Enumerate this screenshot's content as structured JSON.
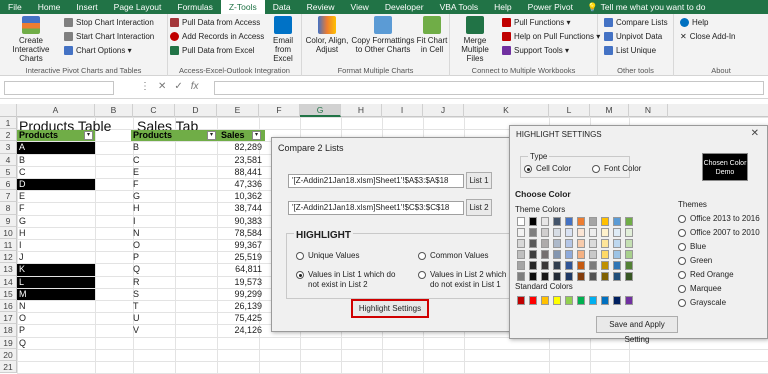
{
  "ribbon_tabs": [
    "File",
    "Home",
    "Insert",
    "Page Layout",
    "Formulas",
    "Z-Tools",
    "Data",
    "Review",
    "View",
    "Developer",
    "VBA Tools",
    "Help",
    "Power Pivot"
  ],
  "active_tab_index": 5,
  "tell_me": "Tell me what you want to do",
  "groups": {
    "g1": {
      "label": "Interactive Pivot Charts and Tables",
      "create": "Create Interactive Charts",
      "stop": "Stop Chart Interaction",
      "start": "Start Chart Interaction",
      "options": "Chart Options"
    },
    "g2": {
      "label": "Access-Excel-Outlook Integration",
      "pull_access": "Pull Data from Access",
      "add_records": "Add Records in Access",
      "pull_excel": "Pull Data from Excel",
      "email": "Email from Excel"
    },
    "g3": {
      "label": "Format Multiple Charts",
      "color": "Color, Align, Adjust",
      "copy_fmt": "Copy Formattings to Other Charts",
      "fit": "Fit Chart in Cell"
    },
    "g4": {
      "label": "Connect to Multiple Workbooks",
      "merge": "Merge Multiple Files",
      "pull_fn": "Pull Functions",
      "help_pull": "Help on Pull Functions",
      "support": "Support Tools"
    },
    "g5": {
      "label": "Other tools",
      "compare": "Compare Lists",
      "unpivot": "Unpivot Data",
      "list_unique": "List Unique"
    },
    "g6": {
      "label": "About",
      "help": "Help",
      "close": "Close Add-In"
    }
  },
  "formula_bar": {
    "fx": "fx",
    "namebox": "",
    "value": ""
  },
  "columns": [
    "A",
    "B",
    "C",
    "D",
    "E",
    "F",
    "G",
    "H",
    "I",
    "J",
    "K",
    "L",
    "M",
    "N"
  ],
  "sheet": {
    "products_title": "Products Table",
    "sales_title": "Sales Tab",
    "products_header": "Products",
    "sales_header_products": "Products",
    "sales_header_sales": "Sales",
    "products": [
      "A",
      "B",
      "C",
      "D",
      "E",
      "F",
      "G",
      "H",
      "I",
      "J",
      "K",
      "L",
      "M",
      "N",
      "O",
      "P",
      "Q"
    ],
    "products_highlighted": [
      true,
      false,
      false,
      true,
      false,
      false,
      false,
      false,
      false,
      false,
      true,
      true,
      true,
      false,
      false,
      false,
      false
    ],
    "sales_products": [
      "B",
      "C",
      "E",
      "F",
      "G",
      "H",
      "I",
      "N",
      "O",
      "P",
      "Q",
      "R",
      "S",
      "T",
      "U",
      "V"
    ],
    "sales_values": [
      "82,289",
      "23,581",
      "88,441",
      "47,336",
      "10,362",
      "38,744",
      "90,383",
      "78,584",
      "99,367",
      "25,519",
      "64,811",
      "19,573",
      "99,299",
      "26,139",
      "75,425",
      "24,126"
    ]
  },
  "compare_dialog": {
    "title": "Compare 2 Lists",
    "list1_ref": "'[Z-Addin21Jan18.xlsm]Sheet1'!$A$3:$A$18",
    "list2_ref": "'[Z-Addin21Jan18.xlsm]Sheet1'!$C$3:$C$18",
    "list1_btn": "List 1",
    "list2_btn": "List 2",
    "highlight_heading": "HIGHLIGHT",
    "opt_unique": "Unique Values",
    "opt_common": "Common Values",
    "opt_list1": "Values in List 1 which do not exist in List 2",
    "opt_list2": "Values in List 2 which do not exist in List 1",
    "settings_btn": "Highlight Settings"
  },
  "hs_dialog": {
    "title": "HIGHLIGHT SETTINGS",
    "close": "✕",
    "type_label": "Type",
    "cell_color": "Cell Color",
    "font_color": "Font Color",
    "demo": "Chosen Color Demo",
    "choose_color": "Choose Color",
    "theme_colors": "Theme Colors",
    "standard_colors": "Standard Colors",
    "themes_label": "Themes",
    "themes": [
      "Office 2013 to 2016",
      "Office 2007 to 2010",
      "Blue",
      "Green",
      "Red Orange",
      "Marquee",
      "Grayscale"
    ],
    "apply_btn": "Save and Apply Setting",
    "theme_grid": [
      [
        "#ffffff",
        "#000000",
        "#e7e6e6",
        "#44546a",
        "#4472c4",
        "#ed7d31",
        "#a5a5a5",
        "#ffc000",
        "#5b9bd5",
        "#70ad47"
      ],
      [
        "#f2f2f2",
        "#7f7f7f",
        "#d0cece",
        "#d6dce4",
        "#d9e2f3",
        "#fbe5d5",
        "#ededed",
        "#fff2cc",
        "#deebf6",
        "#e2efd9"
      ],
      [
        "#d8d8d8",
        "#595959",
        "#aeabab",
        "#adb9ca",
        "#b4c6e7",
        "#f7cbac",
        "#dbdbdb",
        "#fee599",
        "#bdd7ee",
        "#c5e0b3"
      ],
      [
        "#bfbfbf",
        "#3f3f3f",
        "#757070",
        "#8496b0",
        "#8eaadb",
        "#f4b183",
        "#c9c9c9",
        "#ffd965",
        "#9cc3e5",
        "#a8d08d"
      ],
      [
        "#a5a5a5",
        "#262626",
        "#3a3838",
        "#323f4f",
        "#2f5496",
        "#c55a11",
        "#7b7b7b",
        "#bf9000",
        "#2e75b5",
        "#538135"
      ],
      [
        "#7f7f7f",
        "#0c0c0c",
        "#171616",
        "#222a35",
        "#1e3864",
        "#833c0b",
        "#525252",
        "#7f6000",
        "#1f4e79",
        "#375623"
      ]
    ],
    "standard_grid": [
      "#c00000",
      "#ff0000",
      "#ffc000",
      "#ffff00",
      "#92d050",
      "#00b050",
      "#00b0f0",
      "#0070c0",
      "#002060",
      "#7030a0"
    ]
  }
}
